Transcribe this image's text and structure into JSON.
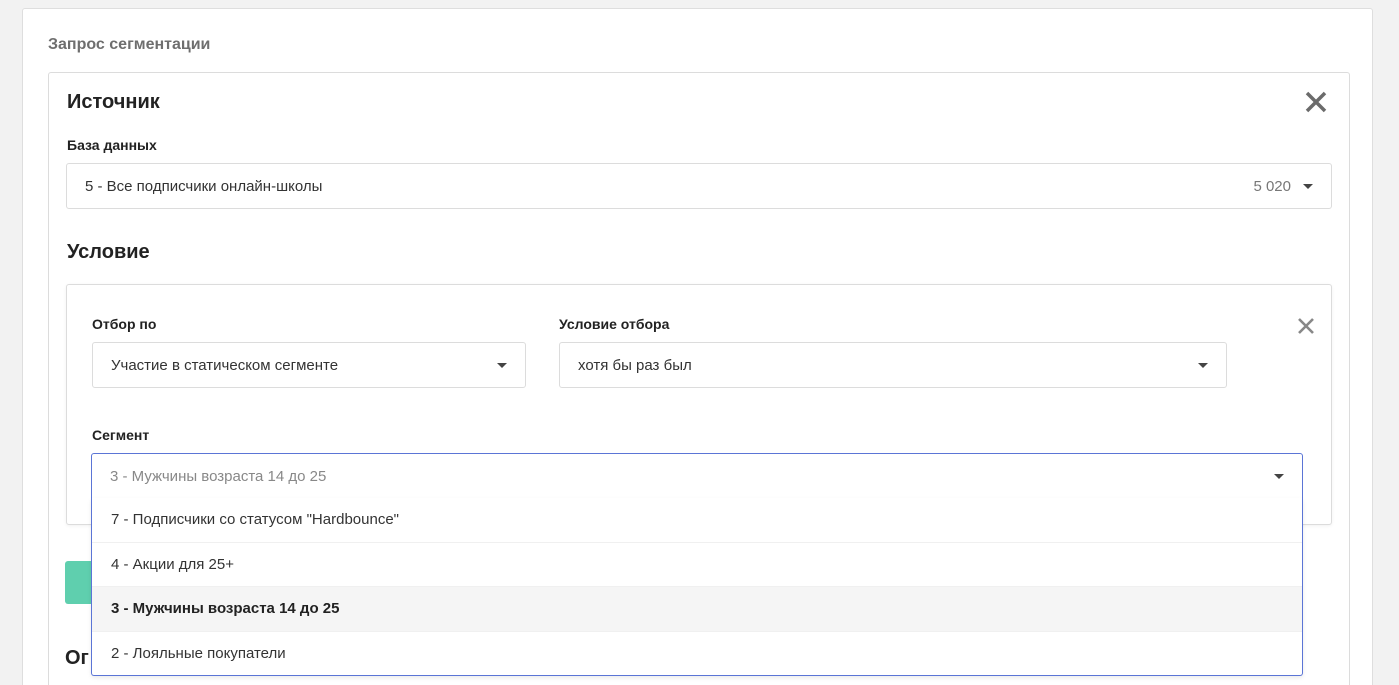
{
  "page": {
    "section_title": "Запрос сегментации"
  },
  "source": {
    "title": "Источник",
    "db_label": "База данных",
    "db_value": "5 - Все подписчики онлайн-школы",
    "db_count": "5 020"
  },
  "condition": {
    "title": "Условие",
    "filter_label": "Отбор по",
    "filter_value": "Участие в статическом сегменте",
    "rule_label": "Условие отбора",
    "rule_value": "хотя бы раз был",
    "segment_label": "Сегмент",
    "segment_value": "3 - Мужчины возраста 14 до 25",
    "segment_options": [
      "7 - Подписчики со статусом \"Hardbounce\"",
      "4 - Акции для 25+",
      "3 - Мужчины возраста 14 до 25",
      "2 - Лояльные покупатели"
    ]
  },
  "next_section": {
    "partial_title": "Ог"
  },
  "colors": {
    "accent_border": "#5b75d6",
    "green_button": "#5fcfae"
  }
}
